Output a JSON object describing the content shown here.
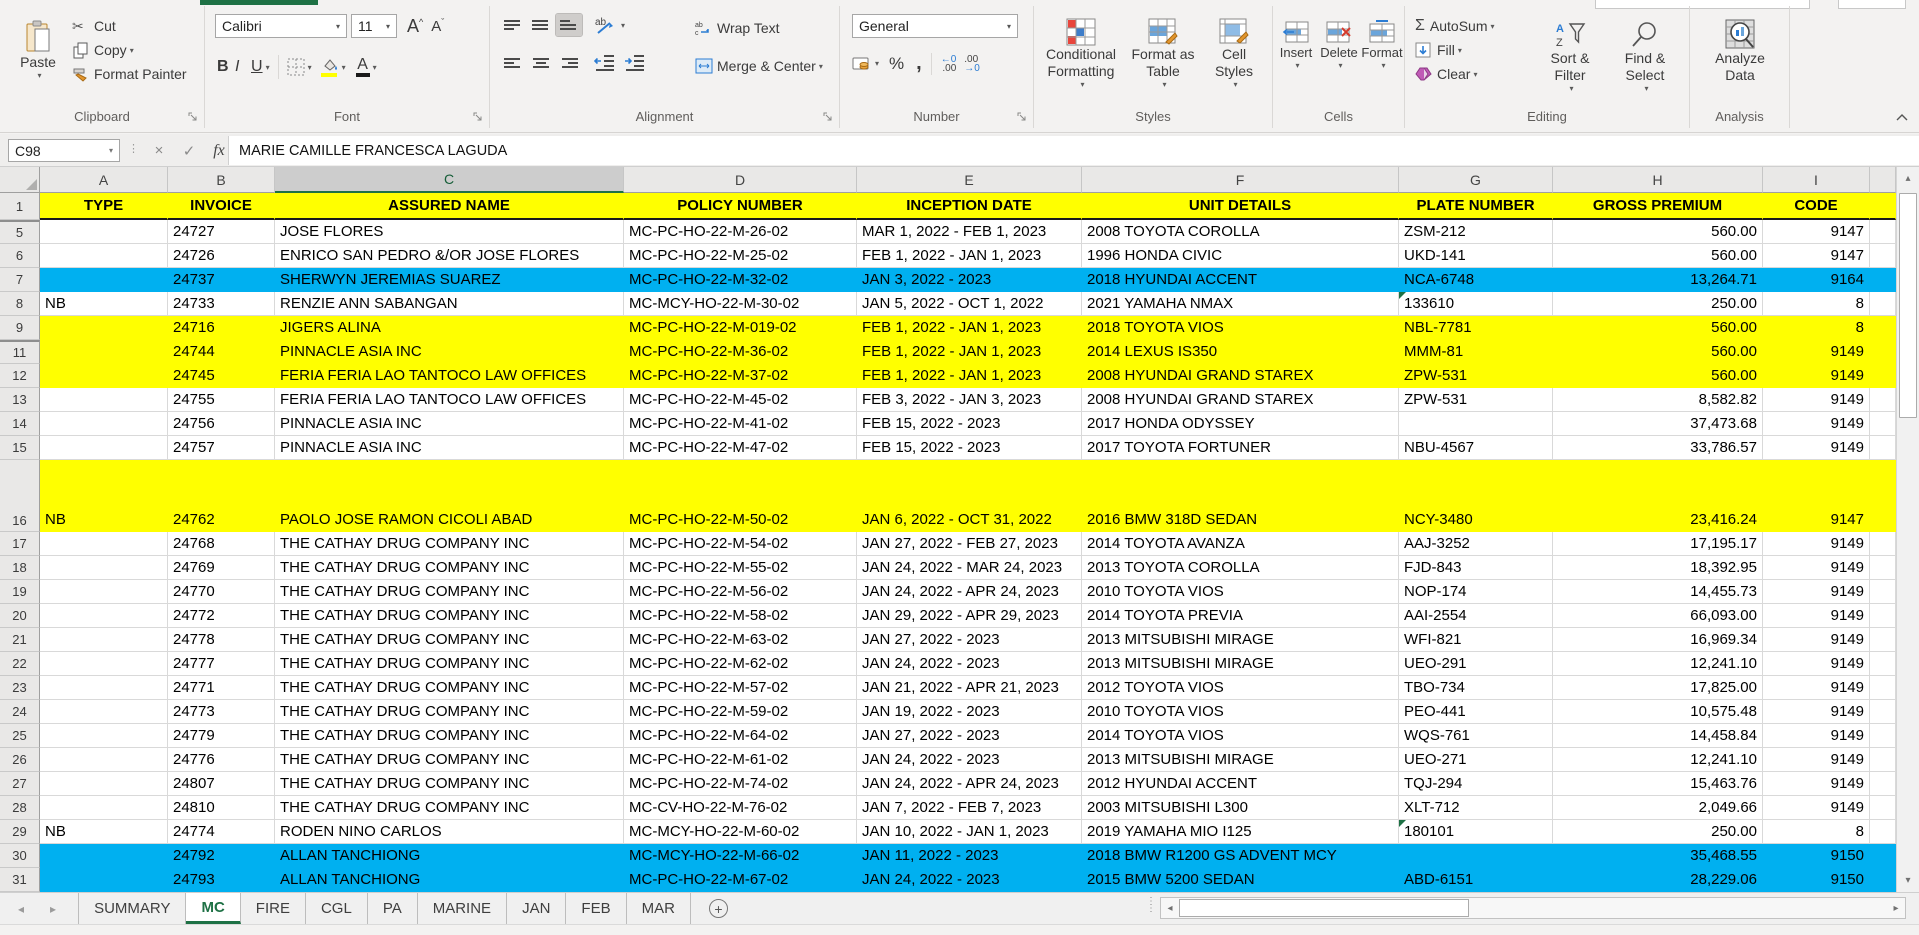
{
  "ribbon": {
    "clipboard": {
      "label": "Clipboard",
      "paste": "Paste",
      "cut": "Cut",
      "copy": "Copy",
      "format_painter": "Format Painter"
    },
    "font": {
      "label": "Font",
      "font_name": "Calibri",
      "font_size": "11",
      "bold": "B",
      "italic": "I",
      "underline": "U"
    },
    "alignment": {
      "label": "Alignment",
      "wrap_text": "Wrap Text",
      "merge_center": "Merge & Center"
    },
    "number": {
      "label": "Number",
      "format": "General",
      "percent": "%",
      "comma": ","
    },
    "styles": {
      "label": "Styles",
      "conditional": "Conditional Formatting",
      "format_table": "Format as Table",
      "cell_styles": "Cell Styles"
    },
    "cells": {
      "label": "Cells",
      "insert": "Insert",
      "delete": "Delete",
      "format": "Format"
    },
    "editing": {
      "label": "Editing",
      "autosum": "AutoSum",
      "fill": "Fill",
      "clear": "Clear",
      "sort_filter": "Sort & Filter",
      "find_select": "Find & Select"
    },
    "analysis": {
      "label": "Analysis",
      "analyze": "Analyze Data"
    }
  },
  "formula_bar": {
    "cell_ref": "C98",
    "formula": "MARIE CAMILLE FRANCESCA LAGUDA"
  },
  "grid": {
    "selected_column": "C",
    "header_row_number": "1",
    "columns": [
      {
        "letter": "A",
        "header": "TYPE"
      },
      {
        "letter": "B",
        "header": "INVOICE"
      },
      {
        "letter": "C",
        "header": "ASSURED NAME"
      },
      {
        "letter": "D",
        "header": "POLICY NUMBER"
      },
      {
        "letter": "E",
        "header": "INCEPTION DATE"
      },
      {
        "letter": "F",
        "header": "UNIT DETAILS"
      },
      {
        "letter": "G",
        "header": "PLATE NUMBER"
      },
      {
        "letter": "H",
        "header": "GROSS PREMIUM"
      },
      {
        "letter": "I",
        "header": "CODE"
      }
    ],
    "rows": [
      {
        "n": "5",
        "bg": "w",
        "gap": true,
        "c": [
          "",
          "24727",
          "JOSE FLORES",
          "MC-PC-HO-22-M-26-02",
          "MAR 1, 2022 - FEB 1, 2023",
          "2008 TOYOTA COROLLA",
          "ZSM-212",
          "560.00",
          "9147"
        ]
      },
      {
        "n": "6",
        "bg": "w",
        "c": [
          "",
          "24726",
          "ENRICO SAN PEDRO &/OR JOSE FLORES",
          "MC-PC-HO-22-M-25-02",
          "FEB 1, 2022 - JAN 1, 2023",
          "1996 HONDA CIVIC",
          "UKD-141",
          "560.00",
          "9147"
        ]
      },
      {
        "n": "7",
        "bg": "b",
        "c": [
          "",
          "24737",
          "SHERWYN JEREMIAS SUAREZ",
          "MC-PC-HO-22-M-32-02",
          "JAN 3, 2022 - 2023",
          "2018 HYUNDAI ACCENT",
          "NCA-6748",
          "13,264.71",
          "9164"
        ]
      },
      {
        "n": "8",
        "bg": "w",
        "tri": 6,
        "c": [
          "NB",
          "24733",
          "RENZIE ANN SABANGAN",
          "MC-MCY-HO-22-M-30-02",
          "JAN 5, 2022 - OCT 1, 2022",
          "2021 YAMAHA NMAX",
          "133610",
          "250.00",
          "8"
        ]
      },
      {
        "n": "9",
        "bg": "y",
        "c": [
          "",
          "24716",
          "JIGERS ALINA",
          "MC-PC-HO-22-M-019-02",
          "FEB 1, 2022 - JAN 1, 2023",
          "2018 TOYOTA VIOS",
          "NBL-7781",
          "560.00",
          "8"
        ]
      },
      {
        "n": "11",
        "bg": "y",
        "gap": true,
        "c": [
          "",
          "24744",
          "PINNACLE ASIA INC",
          "MC-PC-HO-22-M-36-02",
          "FEB 1, 2022 - JAN 1, 2023",
          "2014 LEXUS IS350",
          "MMM-81",
          "560.00",
          "9149"
        ]
      },
      {
        "n": "12",
        "bg": "y",
        "c": [
          "",
          "24745",
          "FERIA FERIA LAO TANTOCO LAW OFFICES",
          "MC-PC-HO-22-M-37-02",
          "FEB 1, 2022 - JAN 1, 2023",
          "2008 HYUNDAI GRAND STAREX",
          "ZPW-531",
          "560.00",
          "9149"
        ]
      },
      {
        "n": "13",
        "bg": "w",
        "c": [
          "",
          "24755",
          "FERIA FERIA LAO TANTOCO LAW OFFICES",
          "MC-PC-HO-22-M-45-02",
          "FEB 3, 2022 - JAN 3, 2023",
          "2008 HYUNDAI GRAND STAREX",
          "ZPW-531",
          "8,582.82",
          "9149"
        ]
      },
      {
        "n": "14",
        "bg": "w",
        "c": [
          "",
          "24756",
          "PINNACLE ASIA INC",
          "MC-PC-HO-22-M-41-02",
          "FEB 15, 2022 - 2023",
          "2017 HONDA ODYSSEY",
          "",
          "37,473.68",
          "9149"
        ]
      },
      {
        "n": "15",
        "bg": "w",
        "c": [
          "",
          "24757",
          "PINNACLE ASIA INC",
          "MC-PC-HO-22-M-47-02",
          "FEB 15, 2022 - 2023",
          "2017 TOYOTA FORTUNER",
          "NBU-4567",
          "33,786.57",
          "9149"
        ]
      },
      {
        "n": "16",
        "bg": "y",
        "tall": true,
        "c": [
          "NB",
          "24762",
          "PAOLO JOSE RAMON CICOLI ABAD",
          "MC-PC-HO-22-M-50-02",
          "JAN 6, 2022 - OCT 31, 2022",
          "2016 BMW 318D SEDAN",
          "NCY-3480",
          "23,416.24",
          "9147"
        ]
      },
      {
        "n": "17",
        "bg": "w",
        "c": [
          "",
          "24768",
          "THE CATHAY DRUG COMPANY INC",
          "MC-PC-HO-22-M-54-02",
          "JAN 27, 2022 - FEB 27, 2023",
          "2014 TOYOTA AVANZA",
          "AAJ-3252",
          "17,195.17",
          "9149"
        ]
      },
      {
        "n": "18",
        "bg": "w",
        "c": [
          "",
          "24769",
          "THE CATHAY DRUG COMPANY INC",
          "MC-PC-HO-22-M-55-02",
          "JAN 24, 2022 - MAR 24, 2023",
          "2013 TOYOTA COROLLA",
          "FJD-843",
          "18,392.95",
          "9149"
        ]
      },
      {
        "n": "19",
        "bg": "w",
        "c": [
          "",
          "24770",
          "THE CATHAY DRUG COMPANY INC",
          "MC-PC-HO-22-M-56-02",
          "JAN 24, 2022 - APR 24, 2023",
          "2010 TOYOTA VIOS",
          "NOP-174",
          "14,455.73",
          "9149"
        ]
      },
      {
        "n": "20",
        "bg": "w",
        "c": [
          "",
          "24772",
          "THE CATHAY DRUG COMPANY INC",
          "MC-PC-HO-22-M-58-02",
          "JAN 29, 2022 - APR 29, 2023",
          "2014 TOYOTA PREVIA",
          "AAI-2554",
          "66,093.00",
          "9149"
        ]
      },
      {
        "n": "21",
        "bg": "w",
        "c": [
          "",
          "24778",
          "THE CATHAY DRUG COMPANY INC",
          "MC-PC-HO-22-M-63-02",
          "JAN 27, 2022 - 2023",
          "2013 MITSUBISHI MIRAGE",
          "WFI-821",
          "16,969.34",
          "9149"
        ]
      },
      {
        "n": "22",
        "bg": "w",
        "c": [
          "",
          "24777",
          "THE CATHAY DRUG COMPANY INC",
          "MC-PC-HO-22-M-62-02",
          "JAN 24, 2022 - 2023",
          "2013 MITSUBISHI MIRAGE",
          "UEO-291",
          "12,241.10",
          "9149"
        ]
      },
      {
        "n": "23",
        "bg": "w",
        "c": [
          "",
          "24771",
          "THE CATHAY DRUG COMPANY INC",
          "MC-PC-HO-22-M-57-02",
          "JAN 21, 2022 - APR 21, 2023",
          "2012 TOYOTA VIOS",
          "TBO-734",
          "17,825.00",
          "9149"
        ]
      },
      {
        "n": "24",
        "bg": "w",
        "c": [
          "",
          "24773",
          "THE CATHAY DRUG COMPANY INC",
          "MC-PC-HO-22-M-59-02",
          "JAN 19, 2022 - 2023",
          "2010 TOYOTA VIOS",
          "PEO-441",
          "10,575.48",
          "9149"
        ]
      },
      {
        "n": "25",
        "bg": "w",
        "c": [
          "",
          "24779",
          "THE CATHAY DRUG COMPANY INC",
          "MC-PC-HO-22-M-64-02",
          "JAN 27, 2022 - 2023",
          "2014 TOYOTA VIOS",
          "WQS-761",
          "14,458.84",
          "9149"
        ]
      },
      {
        "n": "26",
        "bg": "w",
        "c": [
          "",
          "24776",
          "THE CATHAY DRUG COMPANY INC",
          "MC-PC-HO-22-M-61-02",
          "JAN 24, 2022 - 2023",
          "2013 MITSUBISHI MIRAGE",
          "UEO-271",
          "12,241.10",
          "9149"
        ]
      },
      {
        "n": "27",
        "bg": "w",
        "c": [
          "",
          "24807",
          "THE CATHAY DRUG COMPANY INC",
          "MC-PC-HO-22-M-74-02",
          "JAN 24, 2022 - APR 24, 2023",
          "2012 HYUNDAI ACCENT",
          "TQJ-294",
          "15,463.76",
          "9149"
        ]
      },
      {
        "n": "28",
        "bg": "w",
        "c": [
          "",
          "24810",
          "THE CATHAY DRUG COMPANY INC",
          "MC-CV-HO-22-M-76-02",
          "JAN 7, 2022 - FEB 7, 2023",
          "2003 MITSUBISHI L300",
          "XLT-712",
          "2,049.66",
          "9149"
        ]
      },
      {
        "n": "29",
        "bg": "w",
        "tri": 6,
        "c": [
          "NB",
          "24774",
          "RODEN NINO CARLOS",
          "MC-MCY-HO-22-M-60-02",
          "JAN 10, 2022 - JAN 1, 2023",
          "2019 YAMAHA MIO I125",
          "180101",
          "250.00",
          "8"
        ]
      },
      {
        "n": "30",
        "bg": "b",
        "c": [
          "",
          "24792",
          "ALLAN TANCHIONG",
          "MC-MCY-HO-22-M-66-02",
          "JAN 11, 2022 - 2023",
          "2018 BMW R1200 GS ADVENT MCY",
          "",
          "35,468.55",
          "9150"
        ]
      },
      {
        "n": "31",
        "bg": "b",
        "c": [
          "",
          "24793",
          "ALLAN TANCHIONG",
          "MC-PC-HO-22-M-67-02",
          "JAN 24, 2022 - 2023",
          "2015 BMW 5200 SEDAN",
          "ABD-6151",
          "28,229.06",
          "9150"
        ]
      }
    ]
  },
  "sheet_tabs": {
    "tabs": [
      "SUMMARY",
      "MC",
      "FIRE",
      "CGL",
      "PA",
      "MARINE",
      "JAN",
      "FEB",
      "MAR"
    ],
    "active_tab": "MC"
  },
  "colors": {
    "highlight_yellow": "#FFFF00",
    "highlight_blue": "#00B0F0",
    "excel_green": "#1E7145"
  }
}
